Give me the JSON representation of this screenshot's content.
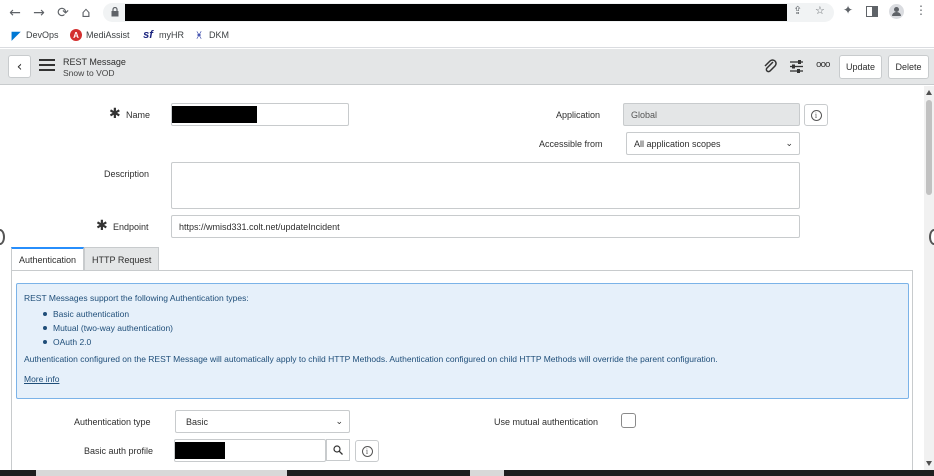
{
  "browser": {
    "nav": {
      "back": "←",
      "forward": "→",
      "reload": "⟳",
      "home": "⌂"
    },
    "icons": [
      "share-icon",
      "star-icon",
      "extensions-icon",
      "sidepanel-icon",
      "profile-icon",
      "more-icon"
    ],
    "bookmarks": [
      {
        "label": "DevOps",
        "icon": "devops-icon",
        "color": "#0078d4"
      },
      {
        "label": "MediAssist",
        "icon": "mediassist-icon",
        "color": "#d32f2f"
      },
      {
        "label": "myHR",
        "icon": "sf-icon",
        "color": "#1a237e"
      },
      {
        "label": "DKM",
        "icon": "dkm-icon",
        "color": "#3949ab"
      }
    ]
  },
  "header": {
    "title": "REST Message",
    "subtitle": "Snow to VOD",
    "update_label": "Update",
    "delete_label": "Delete",
    "more_label": "ooo"
  },
  "form": {
    "name_label": "Name",
    "application_label": "Application",
    "application_value": "Global",
    "accessible_label": "Accessible from",
    "accessible_value": "All application scopes",
    "description_label": "Description",
    "description_value": "",
    "endpoint_label": "Endpoint",
    "endpoint_value": "https://wmisd331.colt.net/updateIncident"
  },
  "tabs": [
    {
      "label": "Authentication",
      "active": true
    },
    {
      "label": "HTTP Request",
      "active": false
    }
  ],
  "auth_info": {
    "intro": "REST Messages support the following Authentication types:",
    "types": [
      "Basic authentication",
      "Mutual (two-way authentication)",
      "OAuth 2.0"
    ],
    "note": "Authentication configured on the REST Message will automatically apply to child HTTP Methods. Authentication configured on child HTTP Methods will override the parent configuration.",
    "more_link": "More info"
  },
  "auth_fields": {
    "auth_type_label": "Authentication type",
    "auth_type_value": "Basic",
    "mutual_label": "Use mutual authentication",
    "mutual_checked": false,
    "profile_label": "Basic auth profile"
  },
  "colors": {
    "accent": "#278efc",
    "header_bg": "#e4e6e7",
    "info_bg": "#e6f0fa",
    "info_text": "#1f4e79"
  }
}
